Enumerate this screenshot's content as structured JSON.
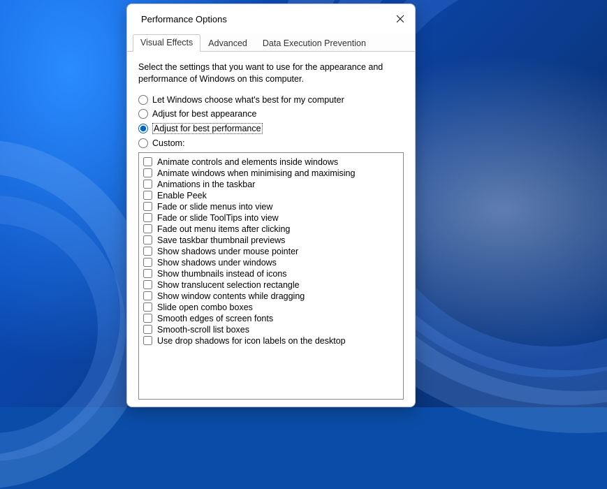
{
  "dialog": {
    "title": "Performance Options",
    "tabs": {
      "visual_effects": "Visual Effects",
      "advanced": "Advanced",
      "dep": "Data Execution Prevention"
    },
    "description": "Select the settings that you want to use for the appearance and performance of Windows on this computer.",
    "radios": {
      "let_windows": "Let Windows choose what's best for my computer",
      "best_appearance": "Adjust for best appearance",
      "best_performance": "Adjust for best performance",
      "custom": "Custom:"
    },
    "options": {
      "o0": "Animate controls and elements inside windows",
      "o1": "Animate windows when minimising and maximising",
      "o2": "Animations in the taskbar",
      "o3": "Enable Peek",
      "o4": "Fade or slide menus into view",
      "o5": "Fade or slide ToolTips into view",
      "o6": "Fade out menu items after clicking",
      "o7": "Save taskbar thumbnail previews",
      "o8": "Show shadows under mouse pointer",
      "o9": "Show shadows under windows",
      "o10": "Show thumbnails instead of icons",
      "o11": "Show translucent selection rectangle",
      "o12": "Show window contents while dragging",
      "o13": "Slide open combo boxes",
      "o14": "Smooth edges of screen fonts",
      "o15": "Smooth-scroll list boxes",
      "o16": "Use drop shadows for icon labels on the desktop"
    }
  }
}
